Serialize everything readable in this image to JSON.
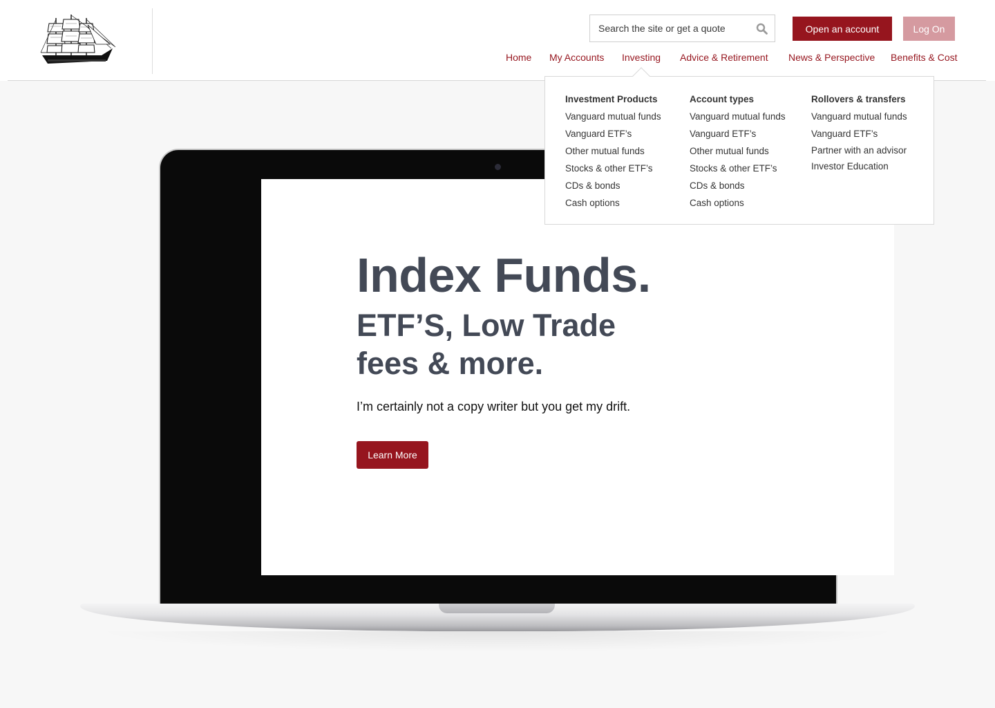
{
  "header": {
    "search_placeholder": "Search the site or get a quote",
    "open_account_label": "Open an account",
    "log_on_label": "Log On"
  },
  "nav": {
    "items": [
      {
        "label": "Home"
      },
      {
        "label": "My Accounts"
      },
      {
        "label": "Investing"
      },
      {
        "label": "Advice & Retirement"
      },
      {
        "label": "News & Perspective"
      },
      {
        "label": "Benefits & Cost"
      }
    ]
  },
  "dropdown": {
    "columns": [
      {
        "heading": "Investment Products",
        "links": [
          "Vanguard mutual funds",
          "Vanguard ETF’s",
          "Other mutual funds",
          "Stocks & other ETF’s",
          "CDs & bonds",
          "Cash options"
        ]
      },
      {
        "heading": "Account types",
        "links": [
          "Vanguard mutual funds",
          "Vanguard ETF’s",
          "Other mutual funds",
          "Stocks & other ETF’s",
          "CDs & bonds",
          "Cash options"
        ]
      },
      {
        "heading": "Rollovers & transfers",
        "links": [
          "Vanguard mutual funds",
          "Vanguard ETF’s",
          "Partner with an advisor",
          "Investor Education"
        ]
      }
    ]
  },
  "hero": {
    "title": "Index Funds.",
    "subtitle": "ETF’S, Low Trade fees & more.",
    "copy": "I’m certainly not a copy writer but you get my drift.",
    "cta_label": "Learn More"
  },
  "colors": {
    "brand": "#96151e",
    "brand_light": "#d59aa0",
    "headline": "#434956",
    "page_bg": "#f7f7f7"
  },
  "icons": {
    "logo": "sailing-ship-logo",
    "search": "magnifier-icon"
  }
}
